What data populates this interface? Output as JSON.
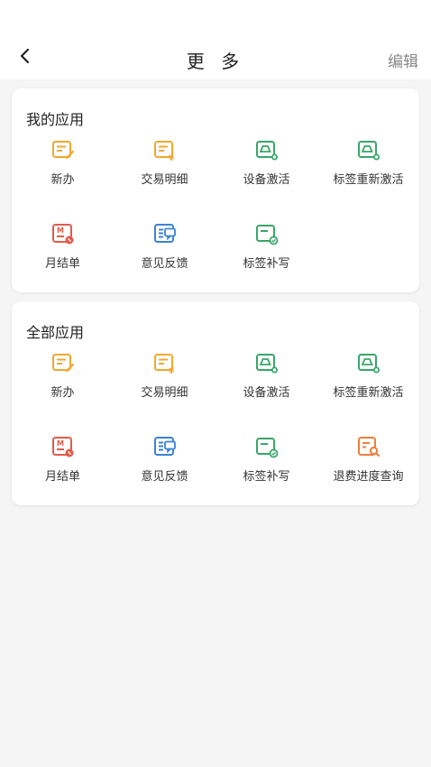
{
  "header": {
    "back_icon": "chevron-left-icon",
    "title": "更 多",
    "edit_label": "编辑"
  },
  "my_apps": {
    "title": "我的应用",
    "items": [
      {
        "label": "新办",
        "icon": "new-handle-icon",
        "color": "#f0a830"
      },
      {
        "label": "交易明细",
        "icon": "transaction-detail-icon",
        "color": "#f0a830"
      },
      {
        "label": "设备激活",
        "icon": "device-activate-icon",
        "color": "#3aa56a"
      },
      {
        "label": "标签重新激活",
        "icon": "tag-reactivate-icon",
        "color": "#3aa56a"
      },
      {
        "label": "月结单",
        "icon": "monthly-statement-icon",
        "color": "#e35a4b"
      },
      {
        "label": "意见反馈",
        "icon": "feedback-icon",
        "color": "#3b82d6"
      },
      {
        "label": "标签补写",
        "icon": "tag-rewrite-icon",
        "color": "#3aa56a"
      }
    ]
  },
  "all_apps": {
    "title": "全部应用",
    "items": [
      {
        "label": "新办",
        "icon": "new-handle-icon",
        "color": "#f0a830"
      },
      {
        "label": "交易明细",
        "icon": "transaction-detail-icon",
        "color": "#f0a830"
      },
      {
        "label": "设备激活",
        "icon": "device-activate-icon",
        "color": "#3aa56a"
      },
      {
        "label": "标签重新激活",
        "icon": "tag-reactivate-icon",
        "color": "#3aa56a"
      },
      {
        "label": "月结单",
        "icon": "monthly-statement-icon",
        "color": "#e35a4b"
      },
      {
        "label": "意见反馈",
        "icon": "feedback-icon",
        "color": "#3b82d6"
      },
      {
        "label": "标签补写",
        "icon": "tag-rewrite-icon",
        "color": "#3aa56a"
      },
      {
        "label": "退费进度查询",
        "icon": "refund-query-icon",
        "color": "#ef7d3c"
      }
    ]
  }
}
